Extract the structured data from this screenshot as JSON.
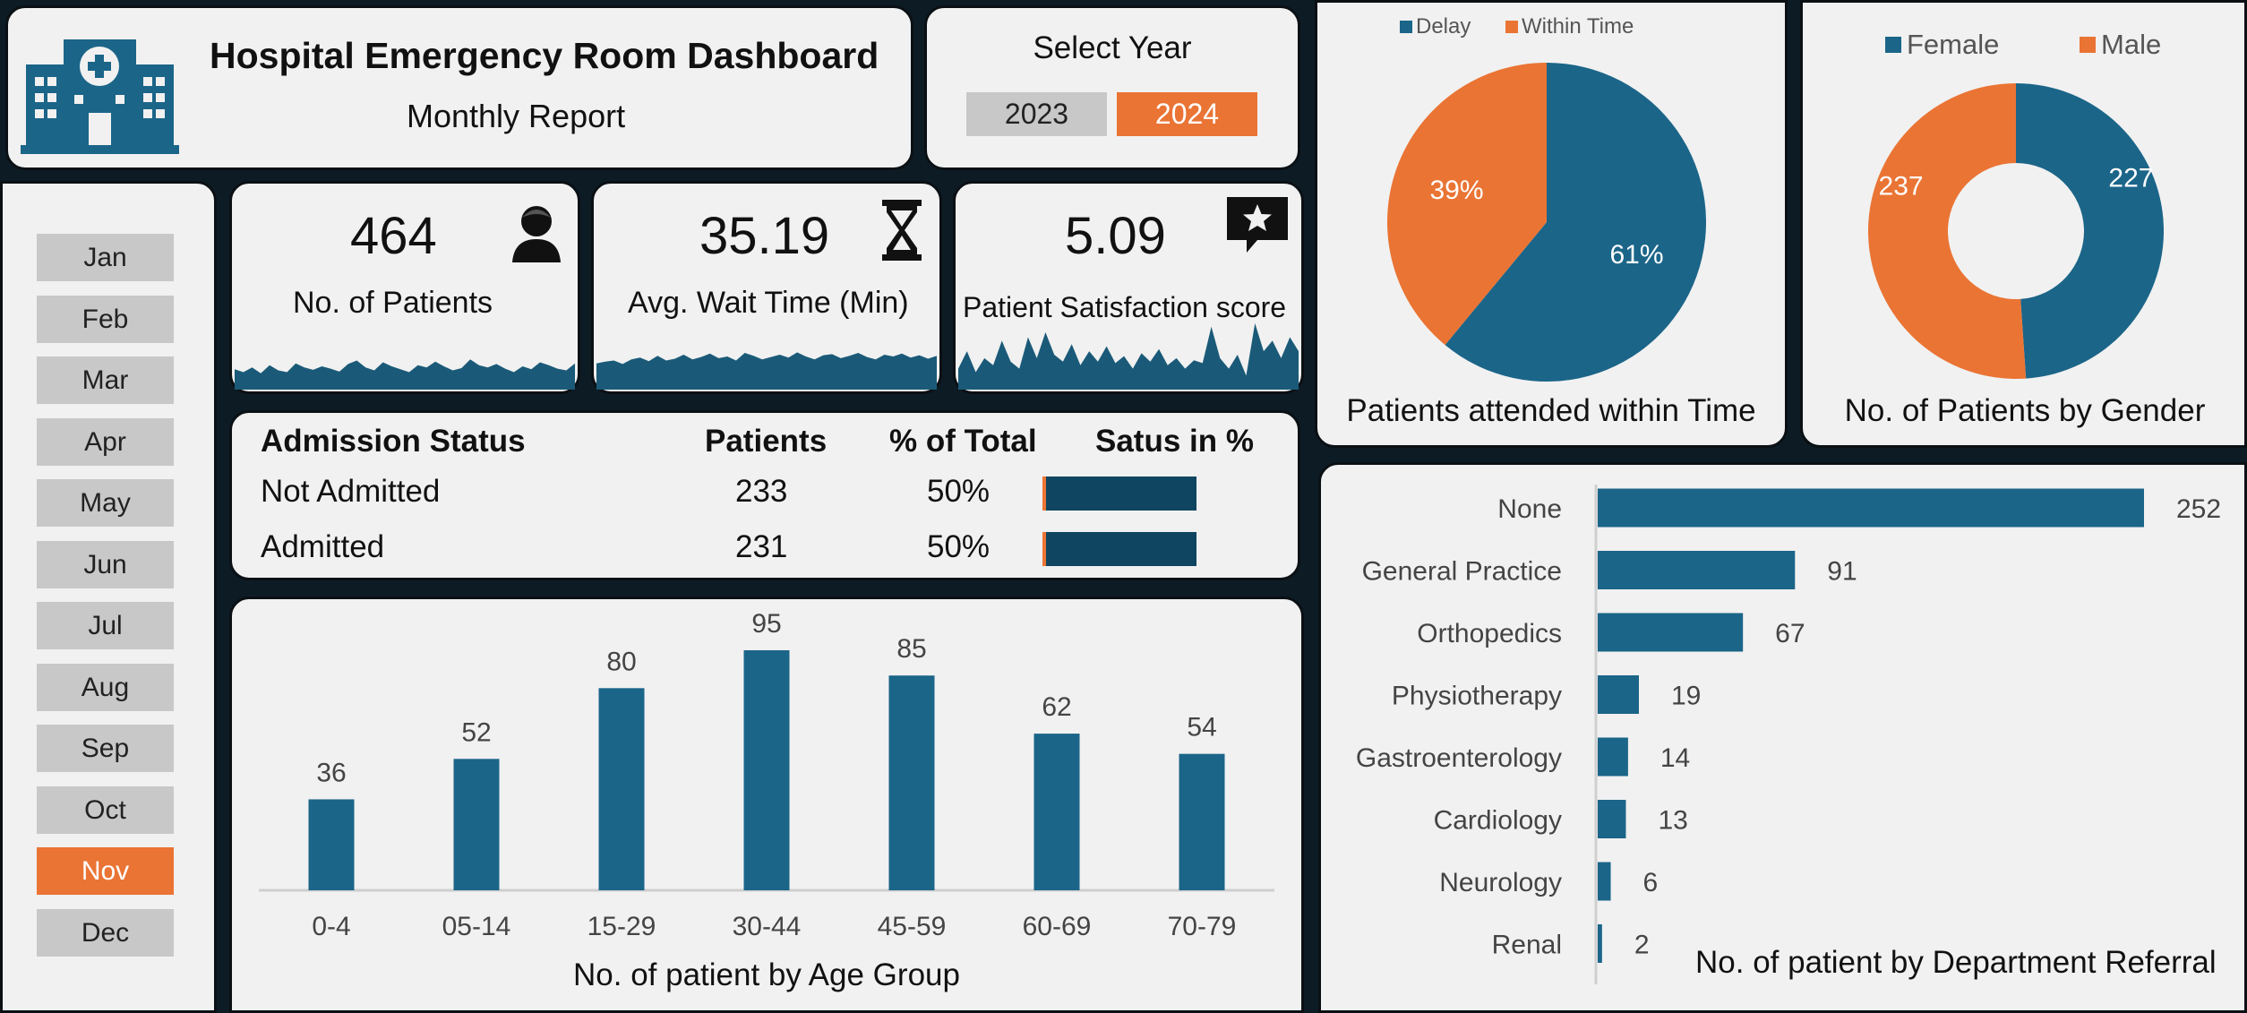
{
  "header": {
    "title": "Hospital Emergency Room Dashboard",
    "subtitle": "Monthly Report"
  },
  "year_selector": {
    "label": "Select Year",
    "years": [
      "2023",
      "2024"
    ],
    "selected": "2024"
  },
  "months": [
    "Jan",
    "Feb",
    "Mar",
    "Apr",
    "May",
    "Jun",
    "Jul",
    "Aug",
    "Sep",
    "Oct",
    "Nov",
    "Dec"
  ],
  "selected_month": "Nov",
  "kpis": [
    {
      "value": "464",
      "label": "No. of Patients",
      "icon": "person-icon"
    },
    {
      "value": "35.19",
      "label": "Avg. Wait Time (Min)",
      "icon": "hourglass-icon"
    },
    {
      "value": "5.09",
      "label": "Patient Satisfaction score",
      "icon": "star-speech-icon"
    }
  ],
  "admission_table": {
    "headers": [
      "Admission Status",
      "Patients",
      "% of Total",
      "Satus in %"
    ],
    "rows": [
      {
        "status": "Not Admitted",
        "patients": "233",
        "pct": "50%",
        "fill": 0.5
      },
      {
        "status": "Admitted",
        "patients": "231",
        "pct": "50%",
        "fill": 0.5
      }
    ]
  },
  "colors": {
    "blue": "#1b6589",
    "orange": "#ea7434",
    "dark": "#0d1b24",
    "panel": "#f1f1f1"
  },
  "chart_data": [
    {
      "type": "pie",
      "title": "Patients attended within Time",
      "legend": [
        "Delay",
        "Within Time"
      ],
      "legend_position": "top",
      "slices": [
        {
          "name": "Delay",
          "value": 61,
          "label": "61%"
        },
        {
          "name": "Within Time",
          "value": 39,
          "label": "39%"
        }
      ]
    },
    {
      "type": "pie",
      "subtype": "donut",
      "title": "No. of Patients by Gender",
      "legend": [
        "Female",
        "Male"
      ],
      "legend_position": "top",
      "slices": [
        {
          "name": "Female",
          "value": 227,
          "label": "227"
        },
        {
          "name": "Male",
          "value": 237,
          "label": "237"
        }
      ]
    },
    {
      "type": "bar",
      "orientation": "vertical",
      "title": "No. of patient by Age Group",
      "categories": [
        "0-4",
        "05-14",
        "15-29",
        "30-44",
        "45-59",
        "60-69",
        "70-79"
      ],
      "values": [
        36,
        52,
        80,
        95,
        85,
        62,
        54
      ],
      "ylim": [
        0,
        95
      ]
    },
    {
      "type": "bar",
      "orientation": "horizontal",
      "title": "No. of patient by Department Referral",
      "categories": [
        "None",
        "General Practice",
        "Orthopedics",
        "Physiotherapy",
        "Gastroenterology",
        "Cardiology",
        "Neurology",
        "Renal"
      ],
      "values": [
        252,
        91,
        67,
        19,
        14,
        13,
        6,
        2
      ],
      "xlim": [
        0,
        252
      ]
    },
    {
      "type": "area",
      "title": "",
      "values": [
        0.35,
        0.3,
        0.38,
        0.28,
        0.42,
        0.33,
        0.3,
        0.45,
        0.38,
        0.34,
        0.4,
        0.36,
        0.31,
        0.44,
        0.5,
        0.38,
        0.33,
        0.47,
        0.4,
        0.35,
        0.3,
        0.42,
        0.38,
        0.48,
        0.4,
        0.33,
        0.37,
        0.52,
        0.42,
        0.38,
        0.44,
        0.36,
        0.3,
        0.4,
        0.35,
        0.47,
        0.42,
        0.36,
        0.33,
        0.45
      ]
    },
    {
      "type": "area",
      "title": "",
      "values": [
        0.45,
        0.48,
        0.5,
        0.44,
        0.52,
        0.55,
        0.49,
        0.58,
        0.5,
        0.53,
        0.6,
        0.52,
        0.56,
        0.62,
        0.54,
        0.57,
        0.5,
        0.63,
        0.58,
        0.52,
        0.56,
        0.6,
        0.55,
        0.64,
        0.57,
        0.52,
        0.59,
        0.61,
        0.54,
        0.58,
        0.63,
        0.56,
        0.52,
        0.6,
        0.57,
        0.62,
        0.55,
        0.59,
        0.53,
        0.58
      ]
    },
    {
      "type": "area",
      "title": "",
      "values": [
        0.3,
        0.55,
        0.25,
        0.45,
        0.35,
        0.7,
        0.4,
        0.3,
        0.75,
        0.45,
        0.82,
        0.5,
        0.4,
        0.65,
        0.35,
        0.55,
        0.4,
        0.62,
        0.38,
        0.48,
        0.3,
        0.52,
        0.4,
        0.58,
        0.35,
        0.45,
        0.3,
        0.42,
        0.38,
        0.9,
        0.45,
        0.3,
        0.5,
        0.2,
        0.95,
        0.55,
        0.7,
        0.45,
        0.75,
        0.55
      ]
    }
  ]
}
